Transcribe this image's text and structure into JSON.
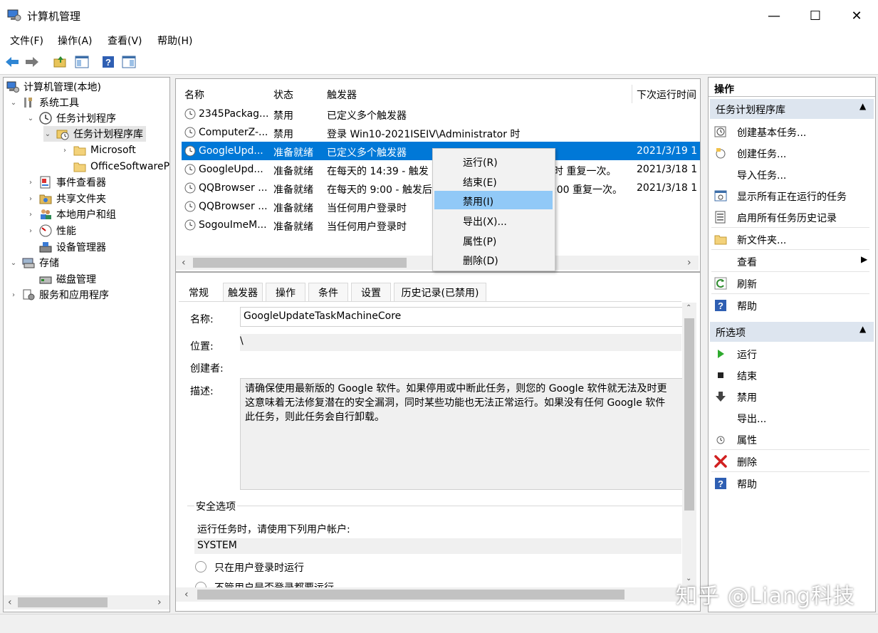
{
  "window": {
    "title": "计算机管理",
    "minimize": "—",
    "maximize": "☐",
    "close": "✕"
  },
  "menu": [
    "文件(F)",
    "操作(A)",
    "查看(V)",
    "帮助(H)"
  ],
  "tree": {
    "items": [
      {
        "label": "计算机管理(本地)",
        "icon": "computer-management-icon",
        "chevron": ""
      },
      {
        "label": "系统工具",
        "icon": "system-tools-icon",
        "chevron": "⌄"
      },
      {
        "label": "任务计划程序",
        "icon": "task-scheduler-icon",
        "chevron": "⌄"
      },
      {
        "label": "任务计划程序库",
        "icon": "folder-clock-icon",
        "chevron": "⌄"
      },
      {
        "label": "Microsoft",
        "icon": "folder-icon",
        "chevron": "›"
      },
      {
        "label": "OfficeSoftwareP",
        "icon": "folder-icon",
        "chevron": ""
      },
      {
        "label": "事件查看器",
        "icon": "event-viewer-icon",
        "chevron": "›"
      },
      {
        "label": "共享文件夹",
        "icon": "shared-folder-icon",
        "chevron": "›"
      },
      {
        "label": "本地用户和组",
        "icon": "users-icon",
        "chevron": "›"
      },
      {
        "label": "性能",
        "icon": "performance-icon",
        "chevron": "›"
      },
      {
        "label": "设备管理器",
        "icon": "device-manager-icon",
        "chevron": ""
      },
      {
        "label": "存储",
        "icon": "storage-icon",
        "chevron": "⌄"
      },
      {
        "label": "磁盘管理",
        "icon": "disk-management-icon",
        "chevron": ""
      },
      {
        "label": "服务和应用程序",
        "icon": "services-icon",
        "chevron": "›"
      }
    ]
  },
  "tasks": {
    "columns": [
      "名称",
      "状态",
      "触发器",
      "下次运行时间"
    ],
    "rows": [
      {
        "name": "2345Packag...",
        "status": "禁用",
        "trigger": "已定义多个触发器",
        "next": ""
      },
      {
        "name": "ComputerZ-...",
        "status": "禁用",
        "trigger": "登录 Win10-2021ISEIV\\Administrator 时",
        "next": ""
      },
      {
        "name": "GoogleUpd...",
        "status": "准备就绪",
        "trigger": "已定义多个触发器",
        "next": "2021/3/19 1"
      },
      {
        "name": "GoogleUpd...",
        "status": "准备就绪",
        "trigger": "在每天的 14:39 - 触发",
        "trigger2": "时 重复一次。",
        "next": "2021/3/18 1"
      },
      {
        "name": "QQBrowser ...",
        "status": "准备就绪",
        "trigger": "在每天的 9:00 - 触发后",
        "trigger2": ":00 重复一次。",
        "next": "2021/3/18 1"
      },
      {
        "name": "QQBrowser ...",
        "status": "准备就绪",
        "trigger": "当任何用户登录时",
        "next": ""
      },
      {
        "name": "SogouImeM...",
        "status": "准备就绪",
        "trigger": "当任何用户登录时",
        "next": ""
      }
    ]
  },
  "context_menu": [
    "运行(R)",
    "结束(E)",
    "禁用(I)",
    "导出(X)...",
    "属性(P)",
    "删除(D)"
  ],
  "detail": {
    "tabs": [
      "常规",
      "触发器",
      "操作",
      "条件",
      "设置",
      "历史记录(已禁用)"
    ],
    "name_label": "名称:",
    "name_value": "GoogleUpdateTaskMachineCore",
    "location_label": "位置:",
    "location_value": "\\",
    "author_label": "创建者:",
    "desc_label": "描述:",
    "desc_lines": [
      "请确保使用最新版的 Google 软件。如果停用或中断此任务，则您的 Google 软件就无法及时更",
      "这意味着无法修复潜在的安全漏洞，同时某些功能也无法正常运行。如果没有任何 Google 软件",
      "此任务，则此任务会自行卸载。"
    ],
    "security_title": "安全选项",
    "run_as_label": "运行任务时，请使用下列用户帐户:",
    "run_as_value": "SYSTEM",
    "radio1": "只在用户登录时运行",
    "radio2": "不管用户是否登录都要运行"
  },
  "actions": {
    "header": "操作",
    "section1": "任务计划程序库",
    "items1": [
      {
        "label": "创建基本任务...",
        "icon": "create-basic-task-icon"
      },
      {
        "label": "创建任务...",
        "icon": "create-task-icon"
      },
      {
        "label": "导入任务...",
        "icon": ""
      },
      {
        "label": "显示所有正在运行的任务",
        "icon": "running-tasks-icon"
      },
      {
        "label": "启用所有任务历史记录",
        "icon": "history-icon"
      },
      {
        "label": "新文件夹...",
        "icon": "new-folder-icon"
      },
      {
        "label": "查看",
        "icon": ""
      },
      {
        "label": "刷新",
        "icon": "refresh-icon"
      },
      {
        "label": "帮助",
        "icon": "help-icon"
      }
    ],
    "section2": "所选项",
    "items2": [
      {
        "label": "运行",
        "icon": "run-icon"
      },
      {
        "label": "结束",
        "icon": "stop-icon"
      },
      {
        "label": "禁用",
        "icon": "disable-icon"
      },
      {
        "label": "导出...",
        "icon": ""
      },
      {
        "label": "属性",
        "icon": "properties-icon"
      },
      {
        "label": "删除",
        "icon": "delete-icon"
      },
      {
        "label": "帮助",
        "icon": "help-icon"
      }
    ]
  },
  "watermark": "知乎 @Liang科技",
  "colors": {
    "selection": "#0078d7",
    "menu_hover": "#91c9f7",
    "section_header": "#dde5ef"
  }
}
